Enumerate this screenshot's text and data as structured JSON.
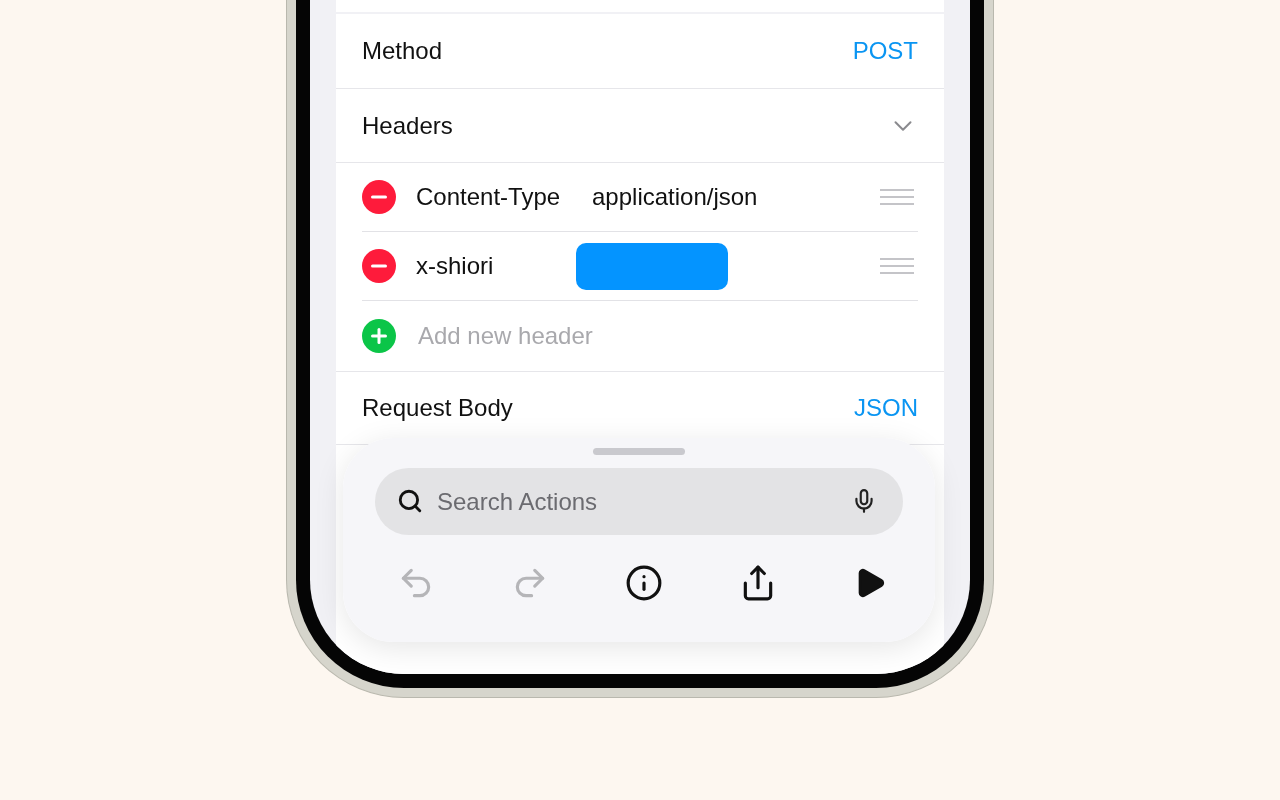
{
  "method": {
    "label": "Method",
    "value": "POST"
  },
  "headers": {
    "label": "Headers",
    "expanded": true,
    "items": [
      {
        "key": "Content-Type",
        "value": "application/json",
        "redacted": false
      },
      {
        "key": "x-shiori",
        "redacted": true
      }
    ],
    "add_placeholder": "Add new header"
  },
  "request_body": {
    "label": "Request Body",
    "value": "JSON"
  },
  "search": {
    "placeholder": "Search Actions"
  },
  "toolbar": [
    {
      "kind": "undo",
      "disabled": true
    },
    {
      "kind": "redo",
      "disabled": true
    },
    {
      "kind": "info",
      "disabled": false
    },
    {
      "kind": "share",
      "disabled": false
    },
    {
      "kind": "run",
      "disabled": false
    }
  ]
}
